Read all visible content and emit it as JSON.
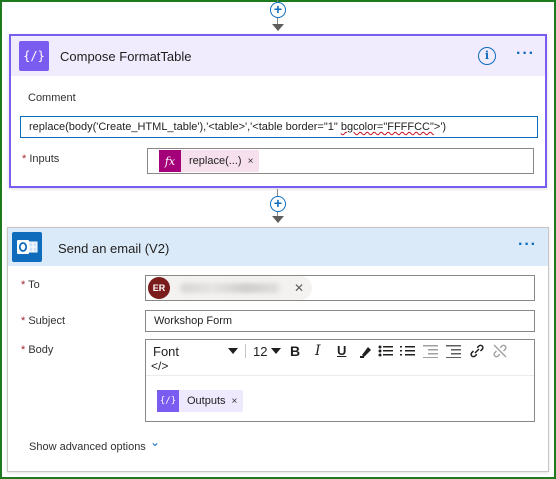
{
  "compose": {
    "title": "Compose FormatTable",
    "comment_label": "Comment",
    "comment_value_prefix": "replace(body('Create_HTML_table'),'<table>','<table border=\"1\" ",
    "comment_value_squiggle": "bgcolor=\"FFFFCC\"",
    "comment_value_suffix": ">')",
    "inputs_label": "Inputs",
    "inputs_token": "replace(...)",
    "token_close": "×",
    "info_icon_glyph": "i",
    "more_icon_glyph": "···",
    "icon_glyph": "{/}",
    "fx_glyph": "fx"
  },
  "email": {
    "title": "Send an email (V2)",
    "more_icon_glyph": "···",
    "to_label": "To",
    "to_avatar": "ER",
    "chip_close": "✕",
    "subject_label": "Subject",
    "subject_value": "Workshop Form",
    "body_label": "Body",
    "font_name": "Font",
    "font_size": "12",
    "bold": "B",
    "italic": "I",
    "underline": "U",
    "code_view": "</>",
    "outputs_token": "Outputs",
    "outputs_glyph": "{/}",
    "token_close": "×",
    "advanced_label": "Show advanced options",
    "chevron_glyph": "⌄"
  },
  "connector": {
    "plus_glyph": "+"
  },
  "required_mark": "*",
  "colors": {
    "compose_accent": "#7a5cf0",
    "email_accent": "#0f6cbd",
    "frame": "#1e7a1e",
    "fx_token": "#a3007a"
  }
}
